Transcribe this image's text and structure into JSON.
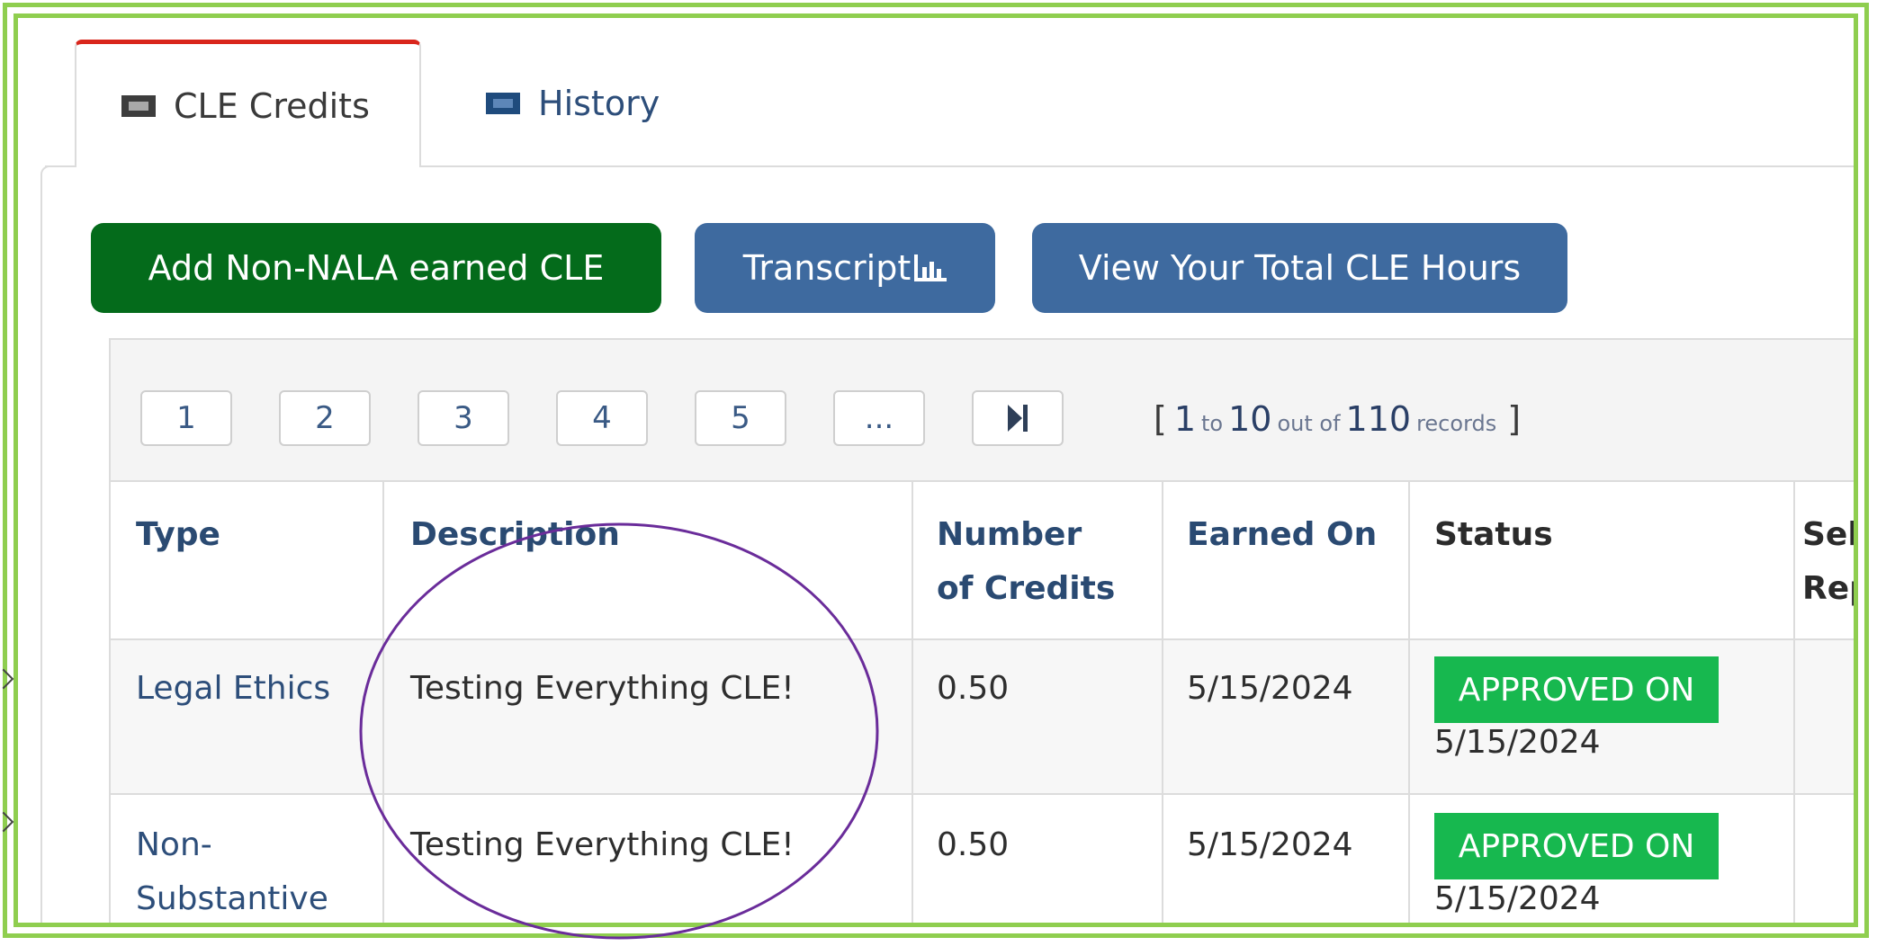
{
  "tabs": [
    {
      "label": "CLE Credits",
      "icon": "id-card-icon",
      "active": true
    },
    {
      "label": "History",
      "icon": "id-card-icon",
      "active": false
    }
  ],
  "actions": {
    "add_label": "Add Non-NALA earned CLE",
    "transcript_label": "Transcript",
    "total_label": "View Your Total CLE Hours"
  },
  "pager": {
    "pages": [
      "1",
      "2",
      "3",
      "4",
      "5",
      "..."
    ],
    "records_open": "[",
    "records_from": "1",
    "records_to_word": "to",
    "records_to": "10",
    "records_out_word": "out of",
    "records_total": "110",
    "records_word": "records",
    "records_close": "]"
  },
  "table": {
    "headers": {
      "type": "Type",
      "description": "Description",
      "credits_line1": "Number",
      "credits_line2": "of Credits",
      "earned": "Earned On",
      "status": "Status",
      "self_line1": "Self",
      "self_line2": "Rep"
    },
    "rows": [
      {
        "type_line1": "Legal Ethics",
        "type_line2": "",
        "description": "Testing Everything CLE!",
        "credits": "0.50",
        "earned": "5/15/2024",
        "status_badge": "APPROVED ON",
        "status_date": "5/15/2024"
      },
      {
        "type_line1": "Non-",
        "type_line2": "Substantive",
        "description": "Testing Everything CLE!",
        "credits": "0.50",
        "earned": "5/15/2024",
        "status_badge": "APPROVED ON",
        "status_date": "5/15/2024"
      }
    ]
  },
  "colors": {
    "frame": "#8fce4f",
    "active_tab_accent": "#d9261c",
    "primary_green": "#046b1b",
    "primary_blue": "#3e6a9f",
    "approved": "#17b84f",
    "annotation": "#6a2c9a"
  }
}
